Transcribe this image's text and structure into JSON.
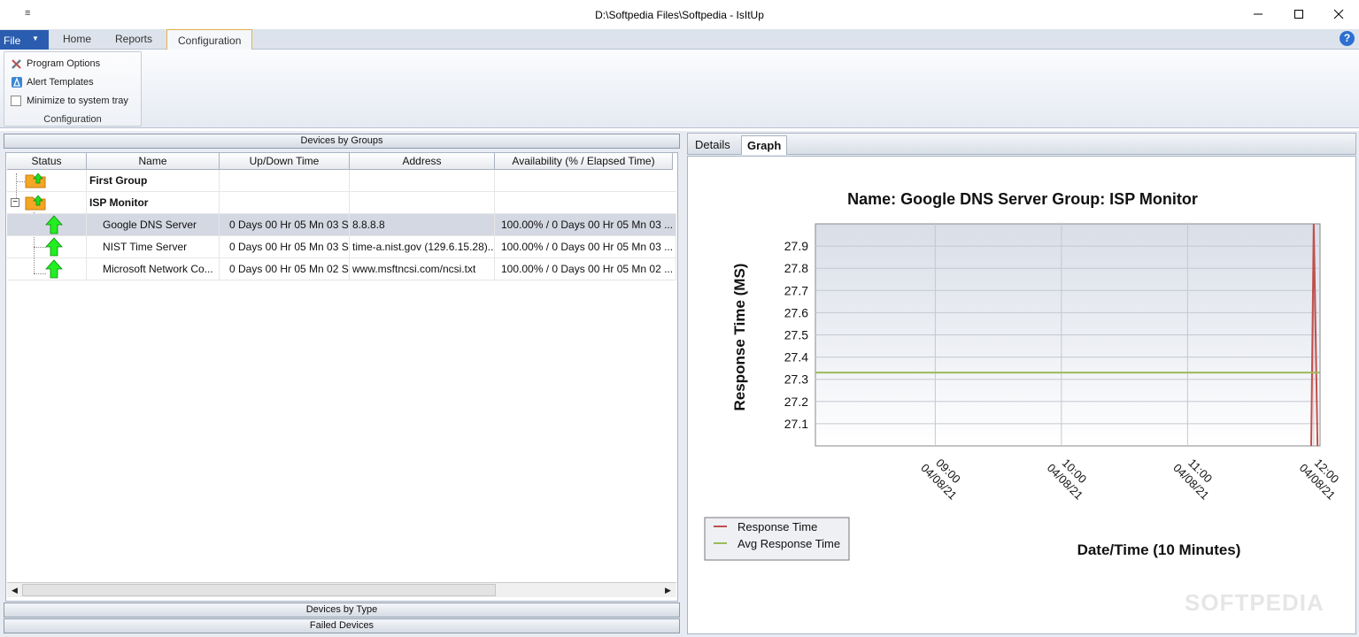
{
  "window": {
    "title": "D:\\Softpedia Files\\Softpedia - IsItUp",
    "qat": "≡"
  },
  "ribbon": {
    "file_label": "File",
    "tabs": [
      {
        "label": "Home"
      },
      {
        "label": "Reports"
      },
      {
        "label": "Configuration"
      }
    ],
    "help_label": "?",
    "group": {
      "label": "Configuration",
      "program_options": "Program Options",
      "alert_templates": "Alert Templates",
      "minimize_tray": "Minimize to system tray"
    }
  },
  "left": {
    "devices_by_groups": "Devices by Groups",
    "devices_by_type": "Devices by Type",
    "failed_devices": "Failed Devices",
    "columns": {
      "status": "Status",
      "name": "Name",
      "updown": "Up/Down Time",
      "address": "Address",
      "availability": "Availability (% / Elapsed Time)"
    },
    "groups": [
      {
        "name": "First Group"
      },
      {
        "name": "ISP Monitor",
        "expander": "−"
      }
    ],
    "devices": [
      {
        "name": "Google DNS Server",
        "updown": "0 Days 00 Hr 05 Mn 03 S...",
        "address": "8.8.8.8",
        "availability": "100.00%  /   0 Days 00 Hr 05 Mn 03 ..."
      },
      {
        "name": "NIST Time Server",
        "updown": "0 Days 00 Hr 05 Mn 03 S...",
        "address": "time-a.nist.gov (129.6.15.28)...",
        "availability": "100.00%  /   0 Days 00 Hr 05 Mn 03 ..."
      },
      {
        "name": "Microsoft Network Co...",
        "updown": "0 Days 00 Hr 05 Mn 02 S...",
        "address": "www.msftncsi.com/ncsi.txt",
        "availability": "100.00%  /   0 Days 00 Hr 05 Mn 02 ..."
      }
    ],
    "scroll_left": "◀",
    "scroll_right": "▶"
  },
  "right": {
    "tabs": [
      {
        "label": "Details"
      },
      {
        "label": "Graph"
      }
    ]
  },
  "chart_data": {
    "type": "line",
    "title": "Name: Google DNS Server  Group: ISP Monitor",
    "xlabel": "Date/Time (10 Minutes)",
    "ylabel": "Response Time (MS)",
    "yticks": [
      "27.1",
      "27.2",
      "27.3",
      "27.4",
      "27.5",
      "27.6",
      "27.7",
      "27.8",
      "27.9"
    ],
    "ylim": [
      27.0,
      28.0
    ],
    "xticks": [
      {
        "time": "09:00",
        "date": "04/08/21",
        "x": 9.0
      },
      {
        "time": "10:00",
        "date": "04/08/21",
        "x": 10.0
      },
      {
        "time": "11:00",
        "date": "04/08/21",
        "x": 11.0
      },
      {
        "time": "12:00",
        "date": "04/08/21",
        "x": 12.0
      }
    ],
    "xlim": [
      8.05,
      12.05
    ],
    "series": [
      {
        "name": "Response Time",
        "color": "#c0504d",
        "x": [
          11.98,
          12.0,
          12.03
        ],
        "y": [
          27.0,
          28.0,
          27.0
        ]
      },
      {
        "name": "Avg Response Time",
        "color": "#9bbb59",
        "x": [
          8.05,
          12.05
        ],
        "y": [
          27.33,
          27.33
        ]
      }
    ],
    "grid": true,
    "legend": "bottom-left"
  },
  "watermark": "SOFTPEDIA"
}
